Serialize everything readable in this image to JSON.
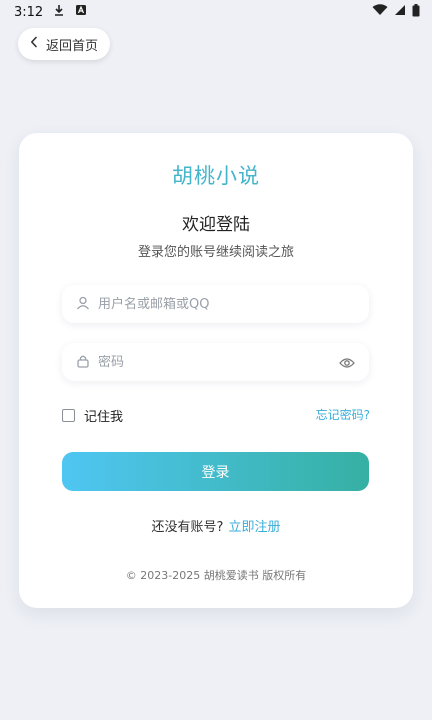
{
  "status_bar": {
    "time": "3:12",
    "icons": [
      "download-icon",
      "notification-a-icon",
      "wifi-icon",
      "signal-icon",
      "battery-icon"
    ]
  },
  "back_button": {
    "label": "返回首页",
    "icon": "chevron-left-icon"
  },
  "card": {
    "app_title": "胡桃小说",
    "welcome": "欢迎登陆",
    "subtitle": "登录您的账号继续阅读之旅",
    "username": {
      "placeholder": "用户名或邮箱或QQ",
      "value": "",
      "icon": "user-icon"
    },
    "password": {
      "placeholder": "密码",
      "value": "",
      "icon": "lock-icon",
      "toggle_icon": "eye-icon"
    },
    "remember_label": "记住我",
    "remember_checked": false,
    "forgot_label": "忘记密码?",
    "login_label": "登录",
    "signup_prompt": "还没有账号?",
    "signup_link": "立即注册",
    "copyright": "© 2023-2025 胡桃爱读书 版权所有"
  },
  "colors": {
    "accent": "#45b5cc",
    "link": "#3aaed8",
    "button_gradient_start": "#4fc6f2",
    "button_gradient_end": "#36b0a3",
    "background": "#eef0f6"
  }
}
